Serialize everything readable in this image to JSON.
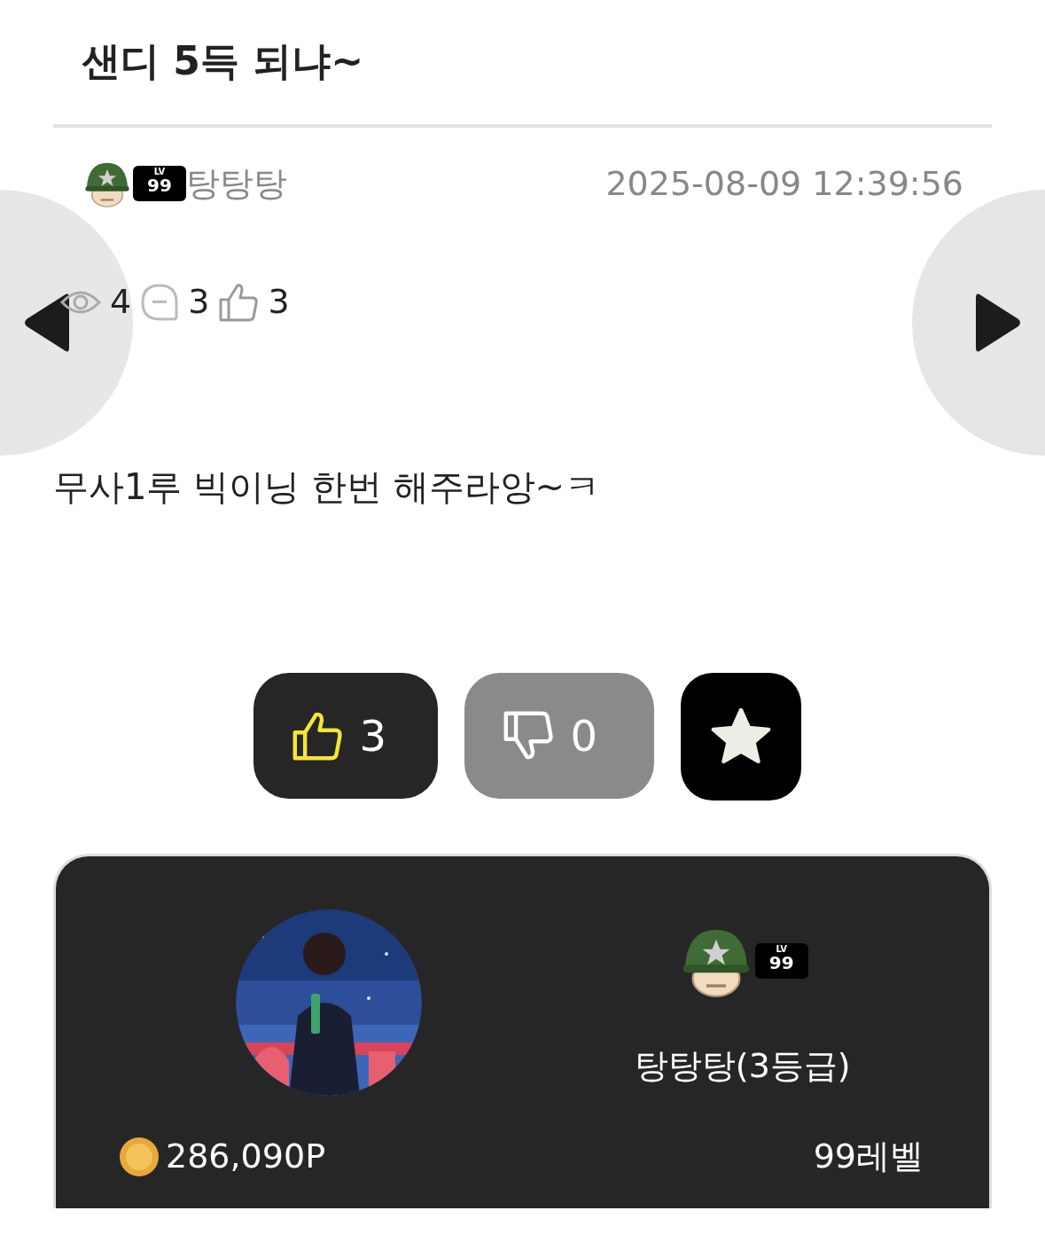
{
  "post": {
    "title": "샌디 5득 되냐~",
    "author": "탕탕탕",
    "datetime": "2025-08-09 12:39:56",
    "level_badge": "LV",
    "level_number": "99",
    "stats": {
      "views": "4",
      "comments": "3",
      "likes": "3"
    },
    "body": "무사1루 빅이닝 한번 해주라앙~ㅋ"
  },
  "votes": {
    "like": "3",
    "dislike": "0"
  },
  "profile": {
    "level_badge": "LV",
    "level_number": "99",
    "name": "탕탕탕(3등급)",
    "points": "286,090P",
    "level": "99레벨"
  }
}
